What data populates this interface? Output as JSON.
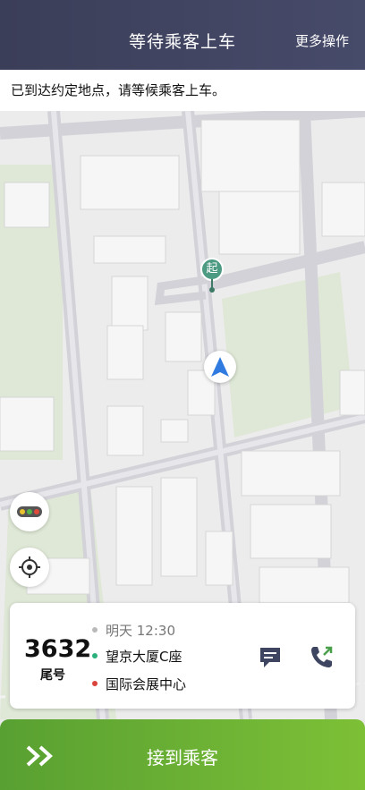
{
  "header": {
    "title": "等待乘客上车",
    "more": "更多操作"
  },
  "notice": {
    "text": "已到达约定地点，请等候乘客上车。"
  },
  "map": {
    "start_pin_label": "起",
    "icons": {
      "traffic": "traffic-light-icon",
      "locate": "crosshair-icon",
      "me": "navigation-arrow-icon"
    }
  },
  "order": {
    "tail_number": "3632",
    "tail_label": "尾号",
    "time": "明天 12:30",
    "pickup": "望京大厦C座",
    "destination": "国际会展中心",
    "icons": {
      "message": "message-icon",
      "call": "phone-icon"
    }
  },
  "action": {
    "label": "接到乘客",
    "icon": "double-chevron-icon"
  },
  "colors": {
    "header": "#3b3e58",
    "accent_green": "#6cb332",
    "pickup_dot": "#2ab07a",
    "dest_dot": "#d9453c",
    "nav_blue": "#2f7be0"
  }
}
